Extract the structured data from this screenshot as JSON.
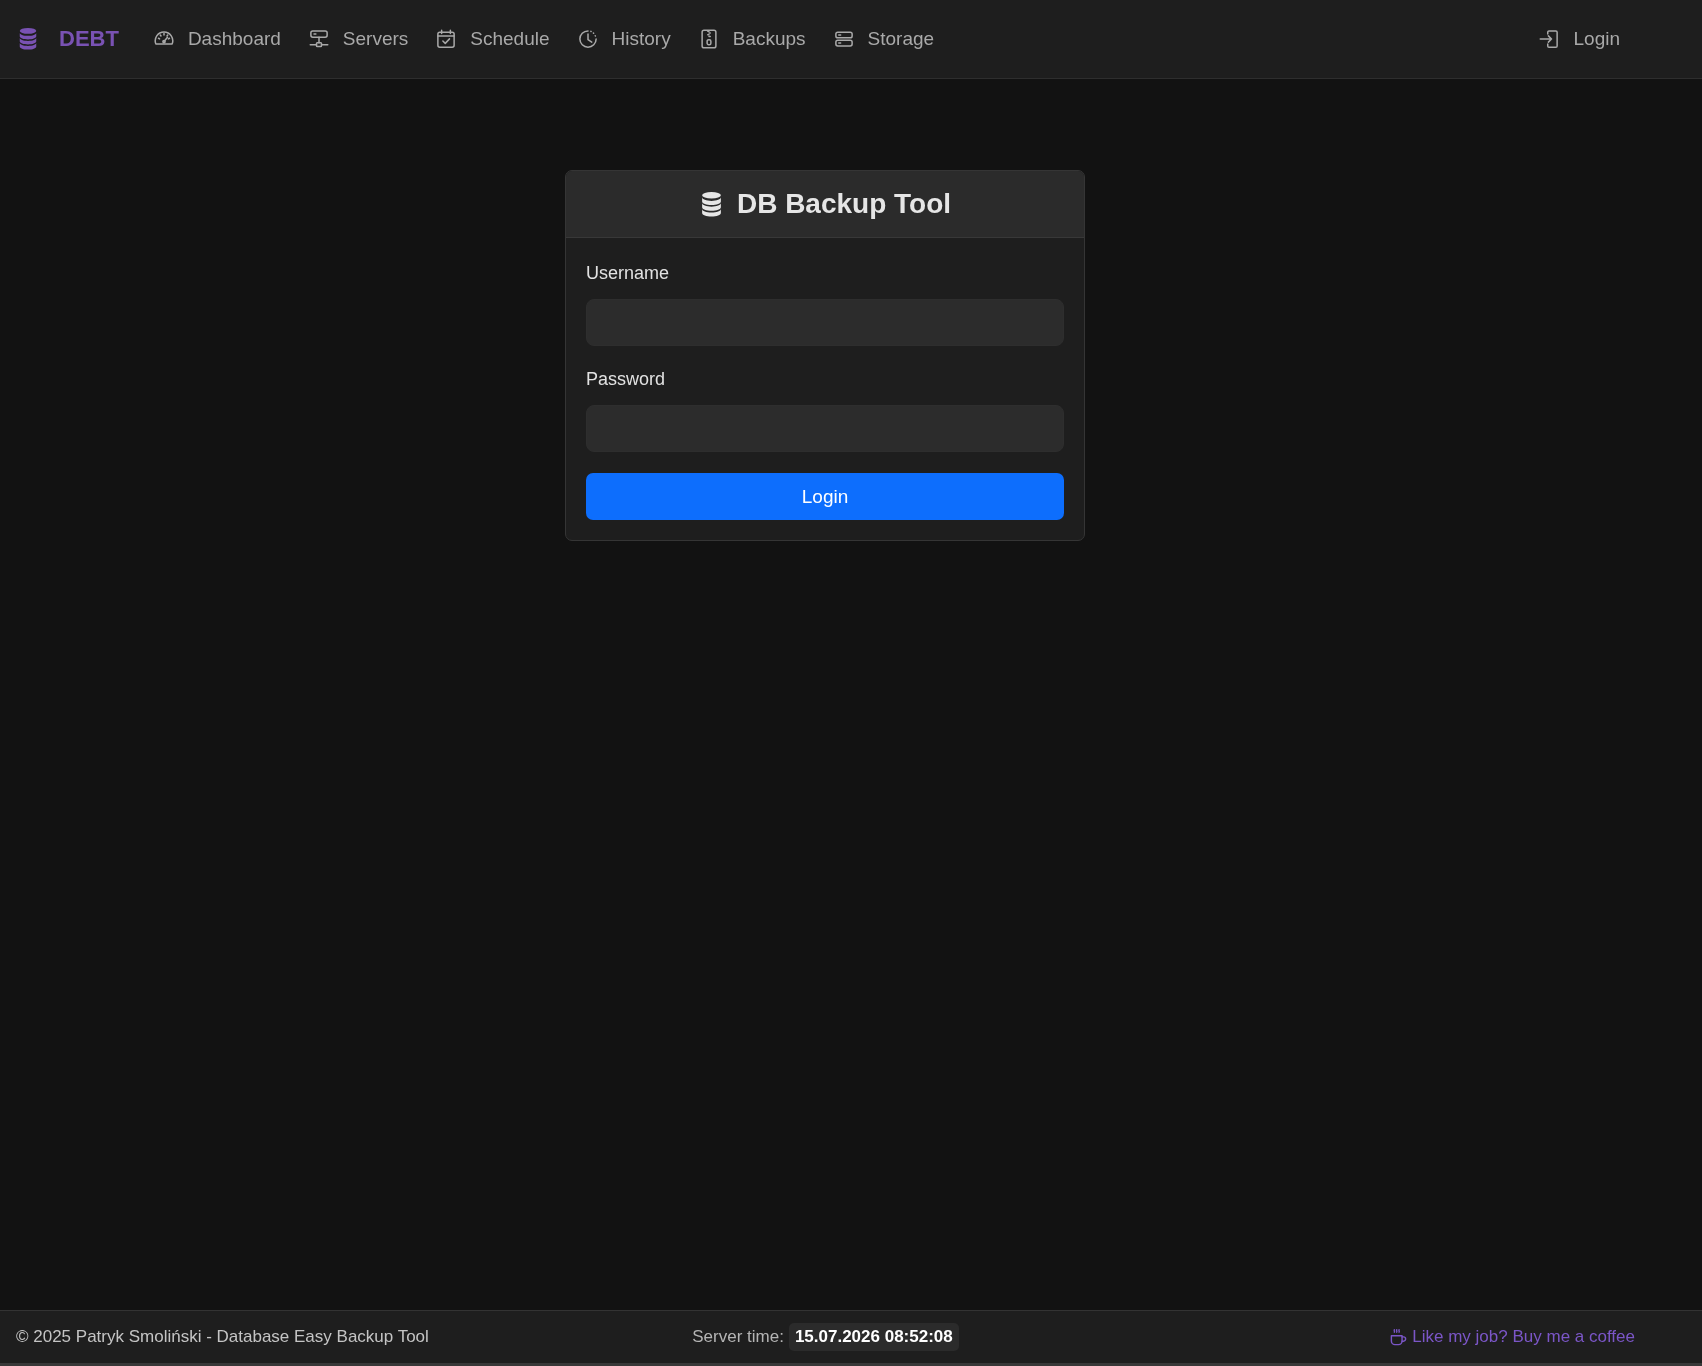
{
  "navbar": {
    "brand": "DEBT",
    "items": [
      {
        "label": "Dashboard",
        "selected": false
      },
      {
        "label": "Servers",
        "selected": false
      },
      {
        "label": "Schedule",
        "selected": false
      },
      {
        "label": "History",
        "selected": false
      },
      {
        "label": "Backups",
        "selected": false
      },
      {
        "label": "Storage",
        "selected": false
      }
    ],
    "login": "Login"
  },
  "login_card": {
    "title": "DB Backup Tool",
    "fields": [
      {
        "label": "Username"
      },
      {
        "label": "Password"
      }
    ],
    "submit": "Login"
  },
  "footer": {
    "copyright": "© 2025 Patryk Smoliński - Database Easy Backup Tool",
    "server_time_label": "Server time:",
    "server_time": "15.07.2026 08:52:08",
    "support_link": "Like my job? Buy me a coffee"
  }
}
